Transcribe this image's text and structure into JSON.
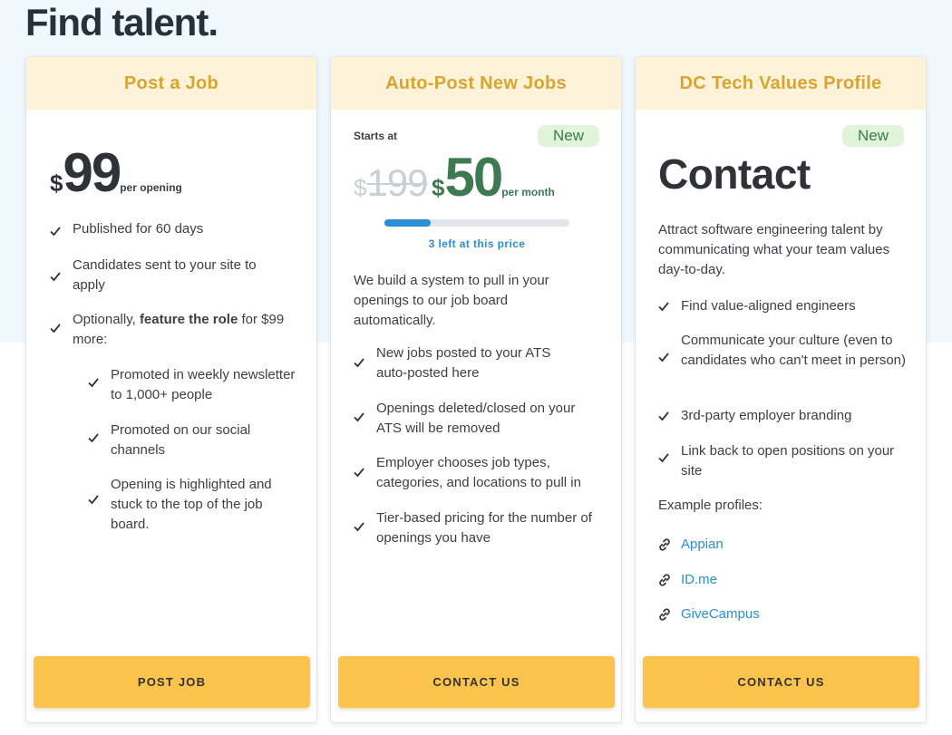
{
  "page": {
    "title_prefix": "Find ",
    "title_highlight": "talent",
    "title_suffix": "."
  },
  "cards": [
    {
      "header": "Post a Job",
      "price_currency": "$",
      "price_amount": "99",
      "price_unit": "per opening",
      "features": [
        "Published for 60 days",
        "Candidates sent to your site to apply"
      ],
      "optional_prefix": "Optionally, ",
      "optional_bold": "feature the role",
      "optional_suffix": " for $99 more:",
      "sub_features": [
        "Promoted in weekly newsletter to 1,000+ people",
        "Promoted on our social channels",
        "Opening is highlighted and stuck to the top of the job board."
      ],
      "cta": "POST JOB"
    },
    {
      "header": "Auto-Post New Jobs",
      "badge": "New",
      "starts_at": "Starts at",
      "old_currency": "$",
      "old_amount": "199",
      "new_currency": "$",
      "new_amount": "50",
      "price_unit": "per month",
      "progress_fraction": 0.25,
      "progress_text": "3 left at this price",
      "description": "We build a system to pull in your openings to our job board automatically.",
      "features": [
        "New jobs posted to your ATS auto-posted here",
        "Openings deleted/closed on your ATS will be removed",
        "Employer chooses job types, categories, and locations to pull in",
        "Tier-based pricing for the number of openings you have"
      ],
      "cta": "CONTACT US"
    },
    {
      "header": "DC Tech Values Profile",
      "badge": "New",
      "price_label": "Contact",
      "description": "Attract software engineering talent by communicating what your team values day-to-day.",
      "features": [
        "Find value-aligned engineers",
        "Communicate your culture (even to candidates who can't meet in person)",
        "3rd-party employer branding",
        "Link back to open positions on your site"
      ],
      "examples_label": "Example profiles:",
      "examples": [
        "Appian",
        "ID.me",
        "GiveCampus"
      ],
      "cta": "CONTACT US"
    }
  ],
  "colors": {
    "accent_yellow": "#fcc44c",
    "header_bg": "#fef3d9",
    "header_text": "#d9a430",
    "price_green": "#3d7a52",
    "link_blue": "#2a8fd4",
    "badge_bg": "#dff4d9"
  },
  "icons": {
    "check": "check-icon",
    "link": "link-icon"
  }
}
